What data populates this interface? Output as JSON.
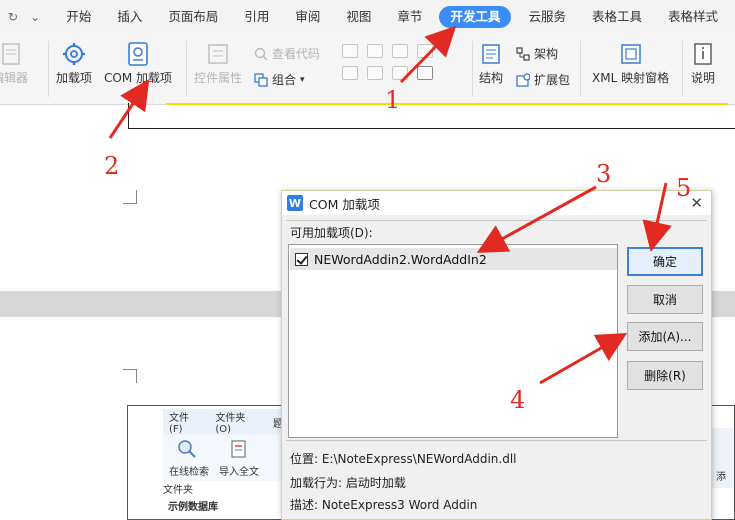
{
  "menubar": {
    "quick_access": [
      "↻",
      "⌄"
    ],
    "tabs": [
      "开始",
      "插入",
      "页面布局",
      "引用",
      "审阅",
      "视图",
      "章节",
      "开发工具",
      "云服务",
      "表格工具",
      "表格样式"
    ],
    "active_tab": "开发工具"
  },
  "ribbon": {
    "editor_label": "编辑器",
    "addins_label": "加载项",
    "com_addins_label": "COM 加载项",
    "control_props_label": "控件属性",
    "view_code_label": "查看代码",
    "group_label": "组合",
    "structure_label": "结构",
    "schema_label": "架构",
    "expansion_pack_label": "扩展包",
    "xml_mapping_label": "XML 映射窗格",
    "help_label": "说明"
  },
  "embedded": {
    "menu_file": "文件 (F)",
    "menu_folder": "文件夹 (O)",
    "menu_cut": "题",
    "online_search": "在线检索",
    "import_fulltext": "导入全文",
    "folder": "文件夹",
    "sample_db": "示例数据库",
    "right_text": "添"
  },
  "dialog": {
    "logo": "W",
    "title": "COM 加载项",
    "available_label": "可用加载项(D):",
    "addins": [
      {
        "name": "NEWordAddin2.WordAddIn2",
        "checked": true
      }
    ],
    "ok_label": "确定",
    "cancel_label": "取消",
    "add_label": "添加(A)...",
    "remove_label": "删除(R)",
    "location": "位置: E:\\NoteExpress\\NEWordAddin.dll",
    "load_behavior": "加载行为: 启动时加载",
    "description": "描述: NoteExpress3 Word Addin",
    "close_symbol": "✕"
  },
  "annotations": [
    "1",
    "2",
    "3",
    "4",
    "5"
  ],
  "colors": {
    "annotation": "#e32a22",
    "active_tab": "#3b8cf7",
    "default_button_border": "#3f7fd6"
  }
}
